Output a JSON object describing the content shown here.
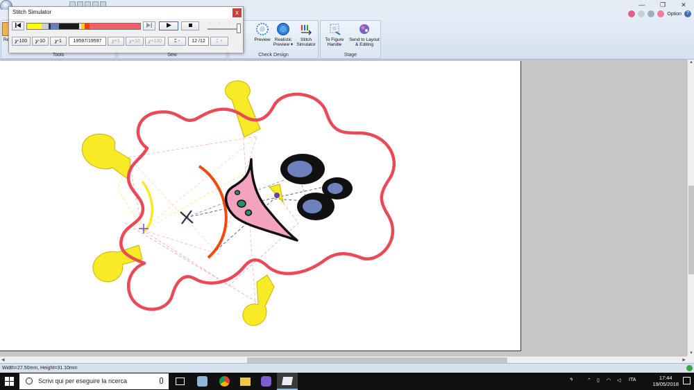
{
  "app": {
    "option_label": "Option",
    "window_controls": [
      "—",
      "❐",
      "✕"
    ]
  },
  "stitch_simulator": {
    "title": "Stitch Simulator",
    "close": "x",
    "color_segments": [
      {
        "color": "#ffff00",
        "fraction": 0.13
      },
      {
        "color": "#cfcfcf",
        "fraction": 0.06
      },
      {
        "color": "#2d2d6b",
        "fraction": 0.02
      },
      {
        "color": "#6a7fb5",
        "fraction": 0.07
      },
      {
        "color": "#1a1a1a",
        "fraction": 0.18
      },
      {
        "color": "#e8e8e8",
        "fraction": 0.02
      },
      {
        "color": "#ffd200",
        "fraction": 0.03
      },
      {
        "color": "#ff3b00",
        "fraction": 0.04
      },
      {
        "color": "#f0606a",
        "fraction": 0.45
      }
    ],
    "step_buttons": [
      "-100",
      "-10",
      "-1"
    ],
    "step_buttons_forward": [
      "+1",
      "+10",
      "+100"
    ],
    "stitch_value": "19597",
    "stitch_total": "/19597",
    "color_value": "12",
    "color_total": "/12",
    "color_minus": "-",
    "color_plus": "+"
  },
  "ribbon": {
    "groups": [
      {
        "label": "Tools"
      },
      {
        "label": "Sew"
      },
      {
        "label": "Check Design"
      },
      {
        "label": "Stage"
      }
    ],
    "check_design_buttons": [
      {
        "label": "Preview"
      },
      {
        "label": "Realistic Preview ▾"
      },
      {
        "label": "Stitch Simulator"
      }
    ],
    "stage_buttons": [
      {
        "label": "To Figure Handle"
      },
      {
        "label": "Send to Layout & Editing"
      }
    ],
    "left_buttons": [
      {
        "label": "Re"
      },
      {
        "label": "g"
      }
    ]
  },
  "status": {
    "text": "Width=27.50mm, Height=31.10mm"
  },
  "taskbar": {
    "search_placeholder": "Scrivi qui per eseguire la ricerca",
    "language": "ITA",
    "time": "17:44",
    "date": "19/05/2018"
  },
  "colors": {
    "outline_red": "#ea4a55",
    "fill_yellow": "#f7ea27",
    "eye_blue": "#6b82bd",
    "mouth_pink": "#f3a3bd",
    "mouth_green": "#2e8b6a",
    "stroke_orange": "#ee4a12"
  }
}
